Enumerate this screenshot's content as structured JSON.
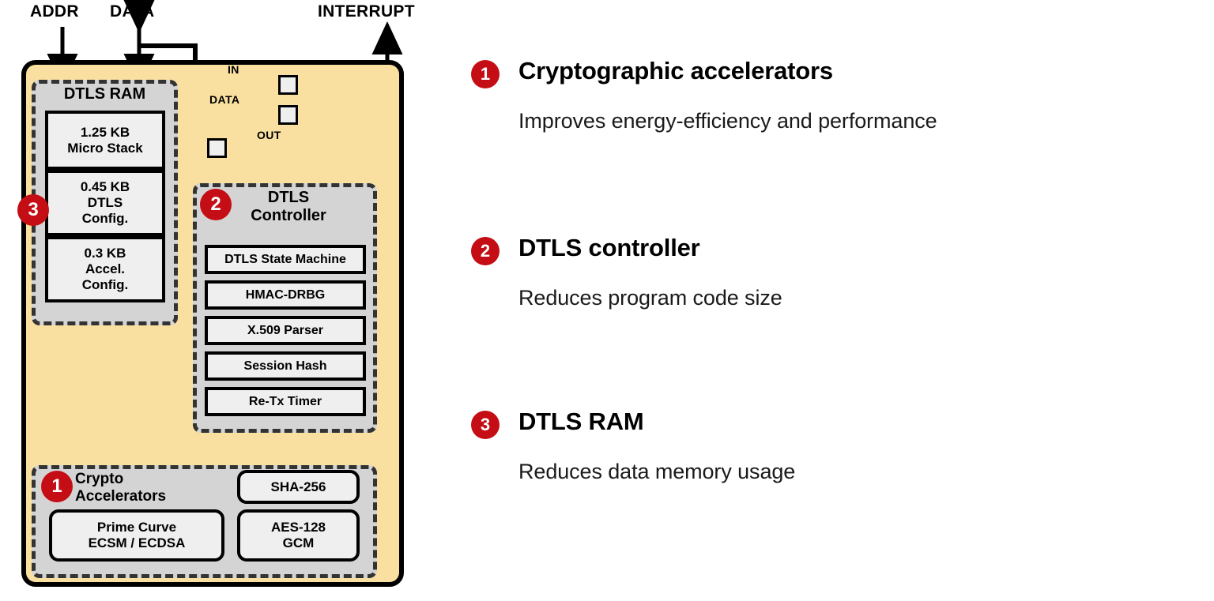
{
  "diagram": {
    "io_labels": [
      {
        "id": "addr",
        "text": "ADDR"
      },
      {
        "id": "data",
        "text": "DATA"
      },
      {
        "id": "interrupt",
        "text": "INTERRUPT"
      }
    ],
    "signal_labels": [
      {
        "id": "in",
        "text": "IN"
      },
      {
        "id": "data_bus",
        "text": "DATA"
      },
      {
        "id": "out",
        "text": "OUT"
      }
    ],
    "ram_group": {
      "title": "DTLS RAM",
      "badge": "3",
      "cells": [
        "1.25 KB\nMicro Stack",
        "0.45 KB\nDTLS\nConfig.",
        "0.3 KB\nAccel.\nConfig."
      ]
    },
    "controller_group": {
      "title": "DTLS\nController",
      "badge": "2",
      "cells": [
        "DTLS State Machine",
        "HMAC-DRBG",
        "X.509 Parser",
        "Session Hash",
        "Re-Tx Timer"
      ]
    },
    "crypto_group": {
      "title": "Crypto\nAccelerators",
      "badge": "1",
      "cells": [
        "SHA-256",
        "AES-128\nGCM",
        "Prime Curve\nECSM / ECDSA"
      ]
    },
    "colors": {
      "chip_fill": "#FAE0A0",
      "group_fill": "#D4D4D4",
      "cell_fill": "#EFEFEF",
      "badge_red": "#C40D14",
      "outline": "#000000",
      "dash_outline": "#333333"
    }
  },
  "panel": {
    "items": [
      {
        "badge": "1",
        "title": "Cryptographic accelerators",
        "description": "Improves energy-efficiency and performance"
      },
      {
        "badge": "2",
        "title": "DTLS controller",
        "description": "Reduces program code size"
      },
      {
        "badge": "3",
        "title": "DTLS RAM",
        "description": "Reduces data memory usage"
      }
    ]
  }
}
